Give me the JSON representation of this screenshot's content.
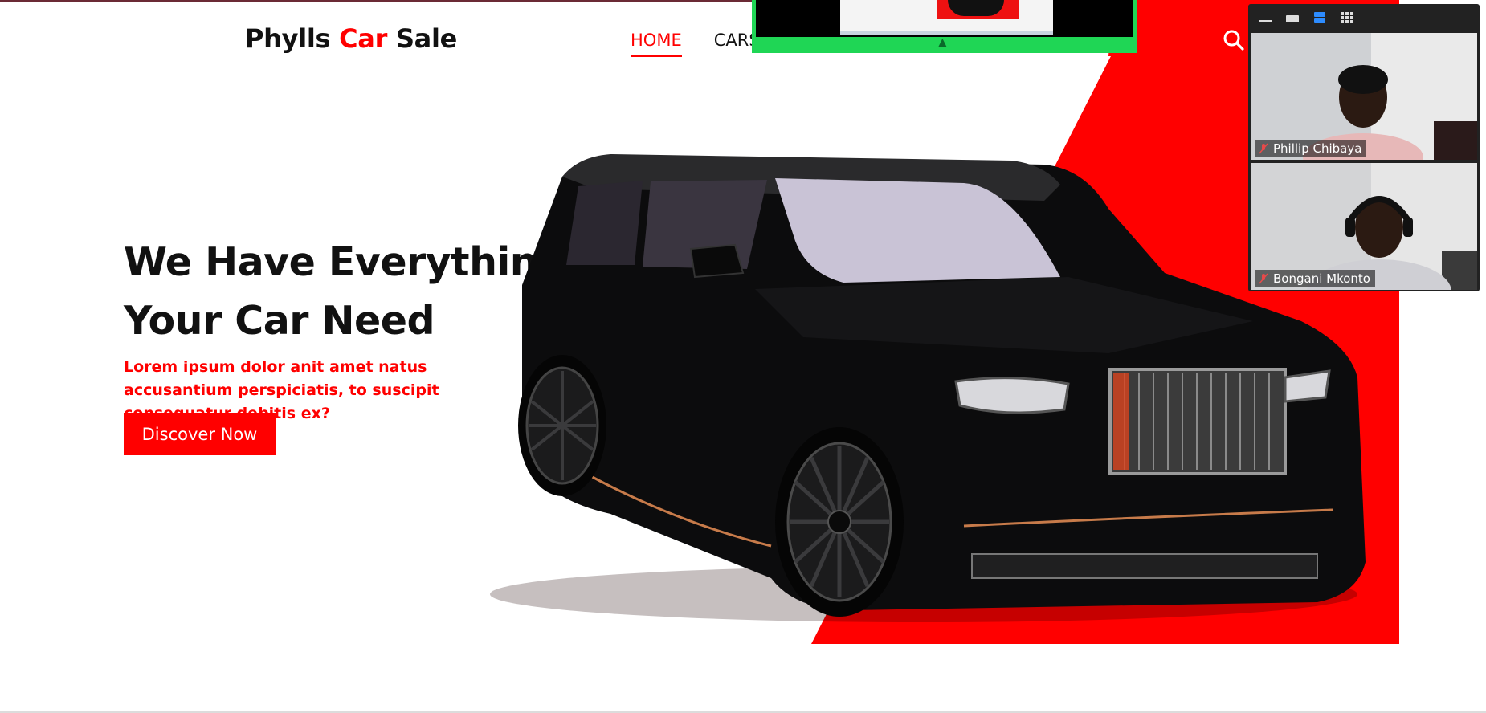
{
  "brand": {
    "name_part1": "Phylls",
    "name_accent": "Car",
    "name_part2": "Sale",
    "accent_color": "#ff0000"
  },
  "nav": {
    "items": [
      {
        "label": "HOME",
        "active": true
      },
      {
        "label": "CARS",
        "active": false
      }
    ]
  },
  "hero": {
    "title_line1": "We Have Everything",
    "title_line2": "Your Car Need",
    "subtitle": "Lorem ipsum dolor anit amet natus accusantium perspiciatis, to suscipit consequatur debitis ex?",
    "cta_label": "Discover Now"
  },
  "icons": {
    "search": "search-icon"
  },
  "meeting": {
    "participants": [
      {
        "name": "Phillip Chibaya",
        "muted": true
      },
      {
        "name": "Bongani Mkonto",
        "muted": true
      }
    ]
  }
}
